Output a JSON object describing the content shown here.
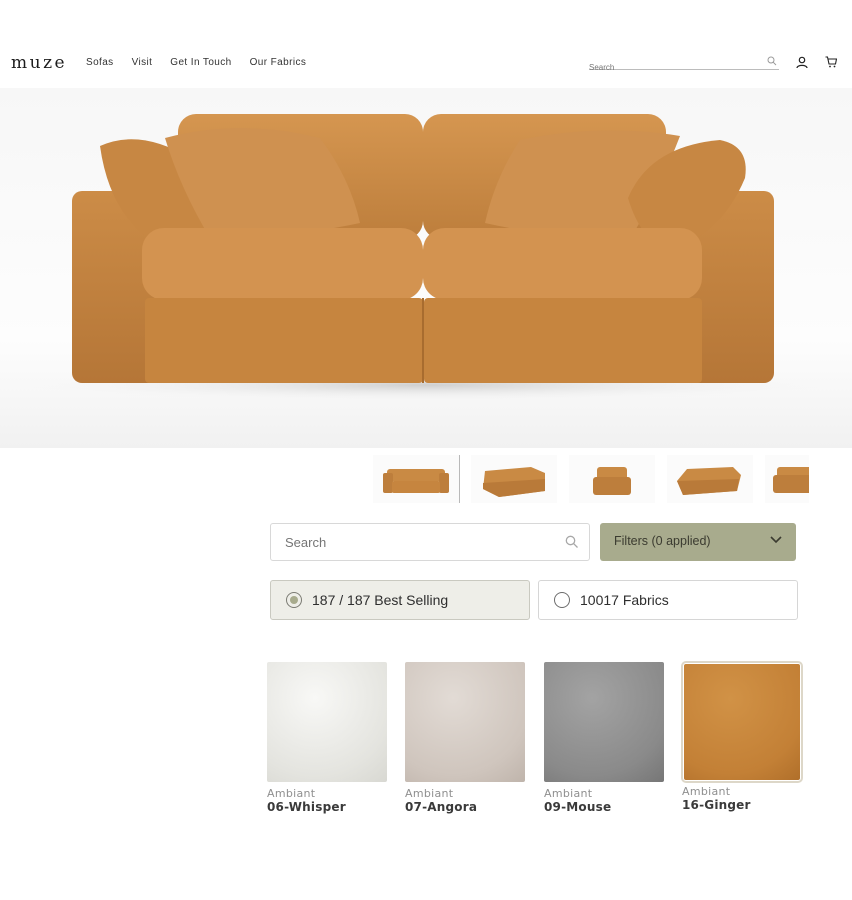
{
  "header": {
    "logo": "muze",
    "nav": [
      "Sofas",
      "Visit",
      "Get In Touch",
      "Our Fabrics"
    ],
    "search_placeholder": "Search",
    "icons": [
      "search-icon",
      "user-icon",
      "cart-icon"
    ]
  },
  "hero": {
    "product_image": "sofa-front-view",
    "color": "#c98a44"
  },
  "thumbnails": [
    {
      "view": "front",
      "selected": true
    },
    {
      "view": "angle-left"
    },
    {
      "view": "chair"
    },
    {
      "view": "angle-right"
    },
    {
      "view": "side"
    }
  ],
  "fabric_finder": {
    "search_placeholder": "Search",
    "filters_label": "Filters (0 applied)",
    "tabs": [
      {
        "label": "187 / 187 Best Selling",
        "selected": true
      },
      {
        "label": "10017 Fabrics",
        "selected": false
      }
    ],
    "swatches": [
      {
        "brand": "Ambiant",
        "name": "06-Whisper",
        "color": "#eeeeea"
      },
      {
        "brand": "Ambiant",
        "name": "07-Angora",
        "color": "#d6cdc6"
      },
      {
        "brand": "Ambiant",
        "name": "09-Mouse",
        "color": "#8c8c8c"
      },
      {
        "brand": "Ambiant",
        "name": "16-Ginger",
        "color": "#c5863a",
        "selected": true
      }
    ]
  },
  "colors": {
    "accent": "#a8ab8d",
    "sofa": "#c98a44"
  }
}
